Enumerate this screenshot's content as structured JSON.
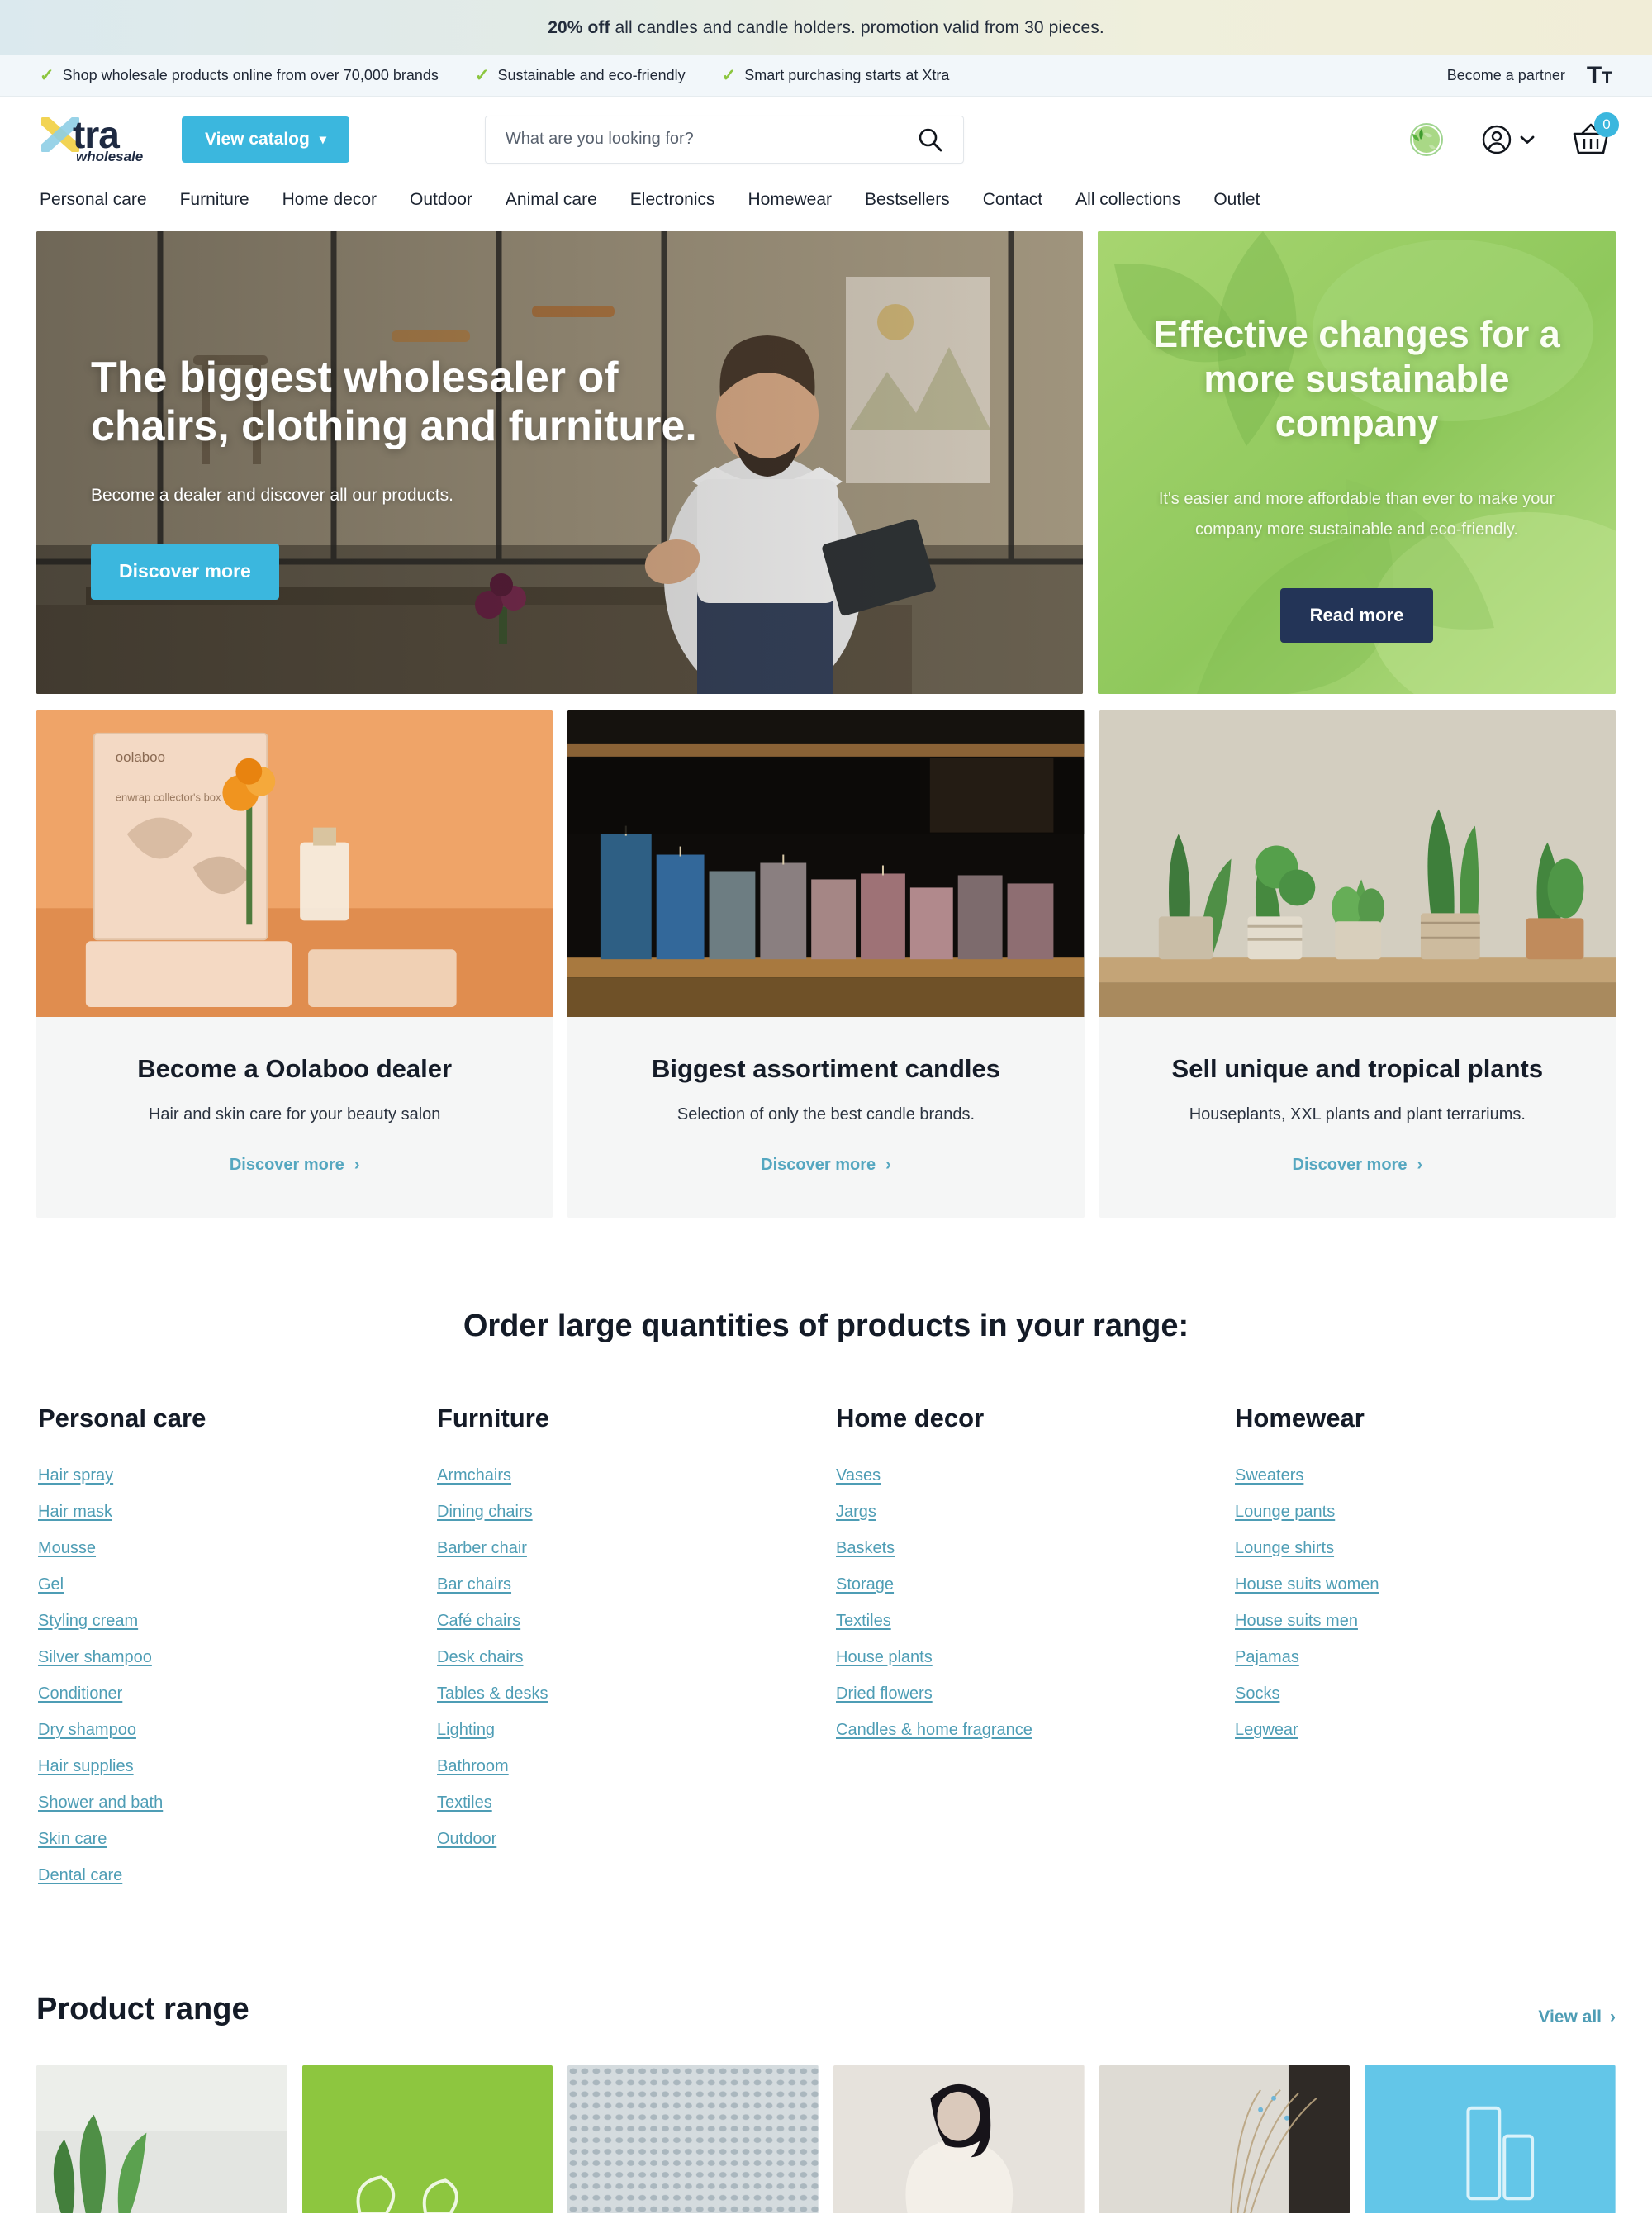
{
  "promo": {
    "strong": "20% off",
    "rest": " all candles and candle holders. promotion valid from 30 pieces."
  },
  "usp_bar": {
    "items": [
      "Shop wholesale products online from over 70,000 brands",
      "Sustainable and eco-friendly",
      "Smart purchasing starts at Xtra"
    ],
    "partner_label": "Become a partner",
    "text_size_icon": "text-size-icon",
    "check_icon": "check-icon"
  },
  "header": {
    "logo_main": "tra",
    "logo_sub": "wholesale",
    "logo_mark": "x-mark-icon",
    "catalog_button": "View catalog",
    "chevron_icon": "chevron-down-icon",
    "search": {
      "placeholder": "What are you looking for?",
      "value": "",
      "icon": "search-icon"
    },
    "eco_icon": "eco-globe-icon",
    "account_icon": "account-circle-icon",
    "account_chevron_icon": "chevron-down-icon",
    "basket_icon": "shopping-basket-icon",
    "cart_count": "0"
  },
  "main_nav": [
    "Personal care",
    "Furniture",
    "Home decor",
    "Outdoor",
    "Animal care",
    "Electronics",
    "Homewear",
    "Bestsellers",
    "Contact",
    "All collections",
    "Outlet"
  ],
  "hero": {
    "title": "The biggest wholesaler of chairs, clothing and furniture.",
    "subtitle": "Become a dealer and discover all our products.",
    "button": "Discover more"
  },
  "hero_side": {
    "title": "Effective changes for a more sustainable company",
    "subtitle": "It's easier and more affordable than ever to make your company more sustainable and eco-friendly.",
    "button": "Read more"
  },
  "feature_cards": [
    {
      "title": "Become a Oolaboo dealer",
      "description": "Hair and skin care for your beauty salon",
      "link": "Discover more",
      "image": "oolaboo-beauty-box-photo"
    },
    {
      "title": "Biggest assortiment candles",
      "description": "Selection of only the best candle brands.",
      "link": "Discover more",
      "image": "candle-shelf-photo"
    },
    {
      "title": "Sell unique and tropical plants",
      "description": "Houseplants, XXL plants and plant terrariums.",
      "link": "Discover more",
      "image": "potted-plants-shelf-photo"
    }
  ],
  "categories_section": {
    "heading": "Order large quantities of products in your range:",
    "columns": [
      {
        "title": "Personal care",
        "links": [
          "Hair spray",
          "Hair mask",
          "Mousse",
          "Gel",
          "Styling cream",
          "Silver shampoo",
          "Conditioner",
          "Dry shampoo",
          "Hair supplies",
          "Shower and bath",
          "Skin care",
          "Dental care"
        ]
      },
      {
        "title": "Furniture",
        "links": [
          "Armchairs",
          "Dining chairs",
          "Barber chair",
          "Bar chairs",
          "Café chairs",
          "Desk chairs",
          "Tables & desks",
          "Lighting",
          "Bathroom",
          "Textiles",
          "Outdoor"
        ]
      },
      {
        "title": "Home decor",
        "links": [
          "Vases",
          "Jargs",
          "Baskets",
          "Storage",
          "Textiles",
          "House plants",
          "Dried flowers",
          "Candles & home fragrance"
        ]
      },
      {
        "title": "Homewear",
        "links": [
          "Sweaters",
          "Lounge pants",
          "Lounge shirts",
          "House suits women",
          "House suits men",
          "Pajamas",
          "Socks",
          "Legwear"
        ]
      }
    ]
  },
  "product_range": {
    "heading": "Product range",
    "view_all": "View all",
    "chevron_icon": "chevron-right-icon",
    "tiles": [
      {
        "name": "green-plant-photo"
      },
      {
        "name": "green-card-tile"
      },
      {
        "name": "grey-dotted-texture-photo"
      },
      {
        "name": "woman-white-sweater-photo"
      },
      {
        "name": "dried-grass-photo"
      },
      {
        "name": "blue-packaging-tile"
      }
    ]
  },
  "colors": {
    "accent_blue": "#3bb7de",
    "link_teal": "#4e9db5",
    "navy": "#233457",
    "green": "#9ccd63",
    "check_green": "#8cc63f"
  }
}
